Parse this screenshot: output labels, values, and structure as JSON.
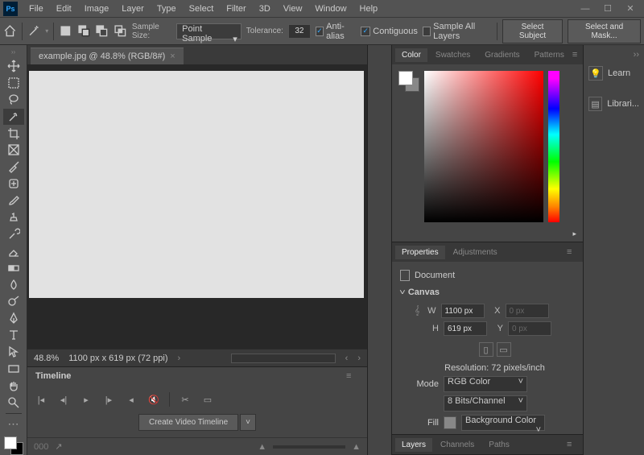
{
  "menu": [
    "File",
    "Edit",
    "Image",
    "Layer",
    "Type",
    "Select",
    "Filter",
    "3D",
    "View",
    "Window",
    "Help"
  ],
  "options": {
    "sample_size_label": "Sample Size:",
    "sample_size_value": "Point Sample",
    "tolerance_label": "Tolerance:",
    "tolerance_value": "32",
    "anti_alias": "Anti-alias",
    "contiguous": "Contiguous",
    "sample_all": "Sample All Layers",
    "select_subject": "Select Subject",
    "select_mask": "Select and Mask..."
  },
  "document": {
    "tab_title": "example.jpg @ 48.8% (RGB/8#)",
    "zoom": "48.8%",
    "dims": "1100 px x 619 px (72 ppi)"
  },
  "timeline": {
    "title": "Timeline",
    "create_video": "Create Video Timeline"
  },
  "color_tabs": [
    "Color",
    "Swatches",
    "Gradients",
    "Patterns"
  ],
  "properties": {
    "tabs": [
      "Properties",
      "Adjustments"
    ],
    "doc_label": "Document",
    "canvas_label": "Canvas",
    "w": "W",
    "h": "H",
    "x": "X",
    "y": "Y",
    "w_val": "1100 px",
    "h_val": "619 px",
    "x_val": "0 px",
    "y_val": "0 px",
    "resolution": "Resolution: 72 pixels/inch",
    "mode_label": "Mode",
    "mode_val": "RGB Color",
    "depth_val": "8 Bits/Channel",
    "fill_label": "Fill",
    "fill_val": "Background Color"
  },
  "layers_tabs": [
    "Layers",
    "Channels",
    "Paths"
  ],
  "right_strip": {
    "learn": "Learn",
    "libraries": "Librari..."
  }
}
